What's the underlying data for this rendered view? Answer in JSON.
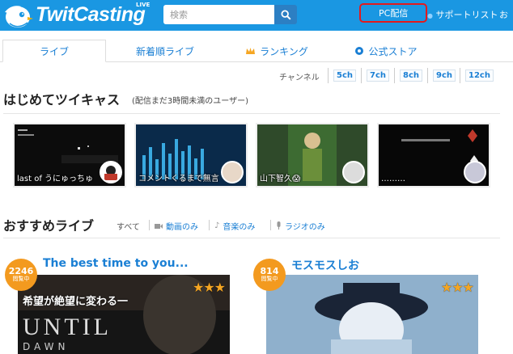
{
  "header": {
    "logo_text": "TwitCasting",
    "logo_live": "LIVE",
    "search_placeholder": "検索",
    "pc_haishin": "PC配信",
    "support_list": "サポートリスト",
    "extra": "お"
  },
  "tabs": [
    {
      "label": "ライブ",
      "active": true
    },
    {
      "label": "新着順ライブ"
    },
    {
      "label": "ランキング",
      "icon": "crown-icon"
    },
    {
      "label": "公式ストア",
      "icon": "store-icon"
    }
  ],
  "channels": {
    "label": "チャンネル",
    "items": [
      "5ch",
      "7ch",
      "8ch",
      "9ch",
      "12ch"
    ]
  },
  "first_time": {
    "title": "はじめてツイキャス",
    "subtitle": "(配信まだ3時間未満のユーザー)",
    "items": [
      {
        "caption": "last of うにゅっちゅ"
      },
      {
        "caption": "コメントくるまで無言"
      },
      {
        "caption": "山下智久😱"
      },
      {
        "caption": "………"
      }
    ]
  },
  "recommended": {
    "title": "おすすめライブ",
    "filters": [
      {
        "label": "すべて"
      },
      {
        "label": "動画のみ",
        "icon": "video-icon"
      },
      {
        "label": "音楽のみ",
        "icon": "music-note-icon"
      },
      {
        "label": "ラジオのみ",
        "icon": "microphone-icon"
      }
    ],
    "items": [
      {
        "title": "The best time to you...",
        "viewers": "2246",
        "status": "閲覧中",
        "stars": "★★★",
        "overlay": "希望が絶望に変わる一",
        "game_title": "UNTIL",
        "game_sub": "DAWN"
      },
      {
        "title": "モスモスしお",
        "viewers": "814",
        "status": "閲覧中",
        "stars": "★★★"
      }
    ]
  },
  "colors": {
    "brand_blue": "#1a97e2",
    "link_blue": "#1a7fd4",
    "badge_orange": "#f39a1f",
    "highlight_red": "#e4191c"
  }
}
